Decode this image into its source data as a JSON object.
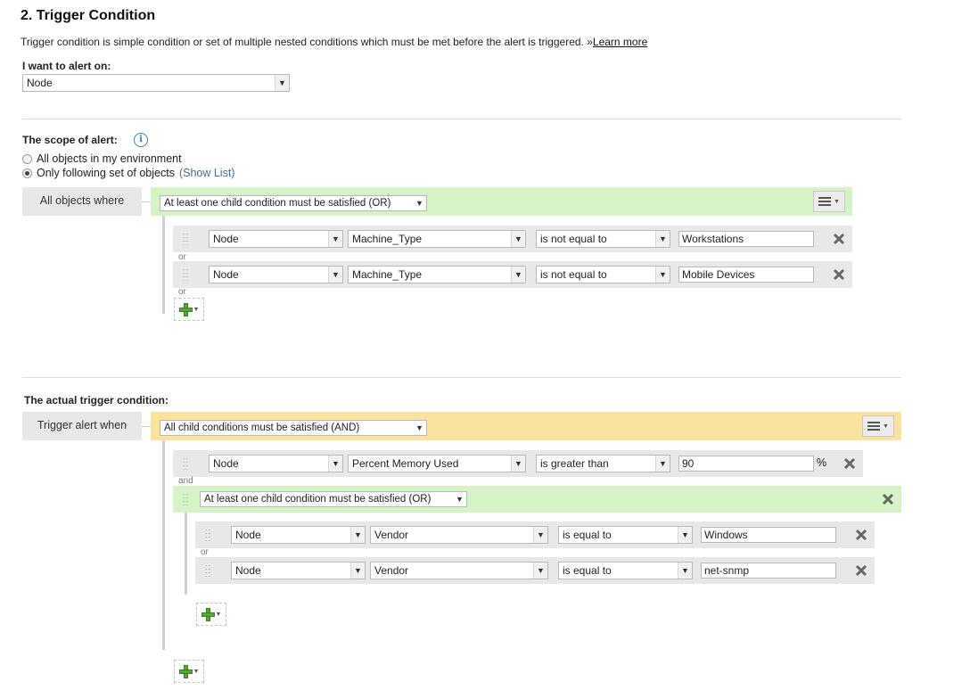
{
  "header": {
    "title": "2. Trigger Condition",
    "description": "Trigger condition is simple condition or set of multiple nested conditions which must be met before the alert is triggered. »",
    "learn_more": "Learn more"
  },
  "alert_on": {
    "label": "I want to alert on:",
    "value": "Node"
  },
  "scope": {
    "label": "The scope of alert:",
    "options": [
      "All objects in my environment",
      "Only following set of objects"
    ],
    "selected_index": 1,
    "show_list": "(Show List)",
    "side_label": "All objects where",
    "group_mode": "At least one child condition must be satisfied (OR)",
    "connector": "or",
    "conditions": [
      {
        "object": "Node",
        "field": "Machine_Type",
        "operator": "is not equal to",
        "value": "Workstations"
      },
      {
        "object": "Node",
        "field": "Machine_Type",
        "operator": "is not equal to",
        "value": "Mobile Devices"
      }
    ]
  },
  "trigger": {
    "label": "The actual trigger condition:",
    "side_label": "Trigger alert when",
    "group_mode": "All child conditions must be satisfied (AND)",
    "connector": "and",
    "condition": {
      "object": "Node",
      "field": "Percent Memory Used",
      "operator": "is greater than",
      "value": "90",
      "unit": "%"
    },
    "nested_group": {
      "mode": "At least one child condition must be satisfied (OR)",
      "connector": "or",
      "conditions": [
        {
          "object": "Node",
          "field": "Vendor",
          "operator": "is equal to",
          "value": "Windows"
        },
        {
          "object": "Node",
          "field": "Vendor",
          "operator": "is equal to",
          "value": "net-snmp"
        }
      ]
    }
  },
  "icons": {
    "info": "i",
    "dropdown_arrow": "▼",
    "menu_caret": "▼",
    "remove": "close-x-icon",
    "add": "green-plus-icon",
    "drag": "drag-handle-icon"
  },
  "colors": {
    "or_group_band": "#d6f3c7",
    "and_group_band": "#fbe39e",
    "condition_row": "#e8e8e8",
    "link": "#3b6ea5",
    "add_plus": "#5aa33a"
  }
}
